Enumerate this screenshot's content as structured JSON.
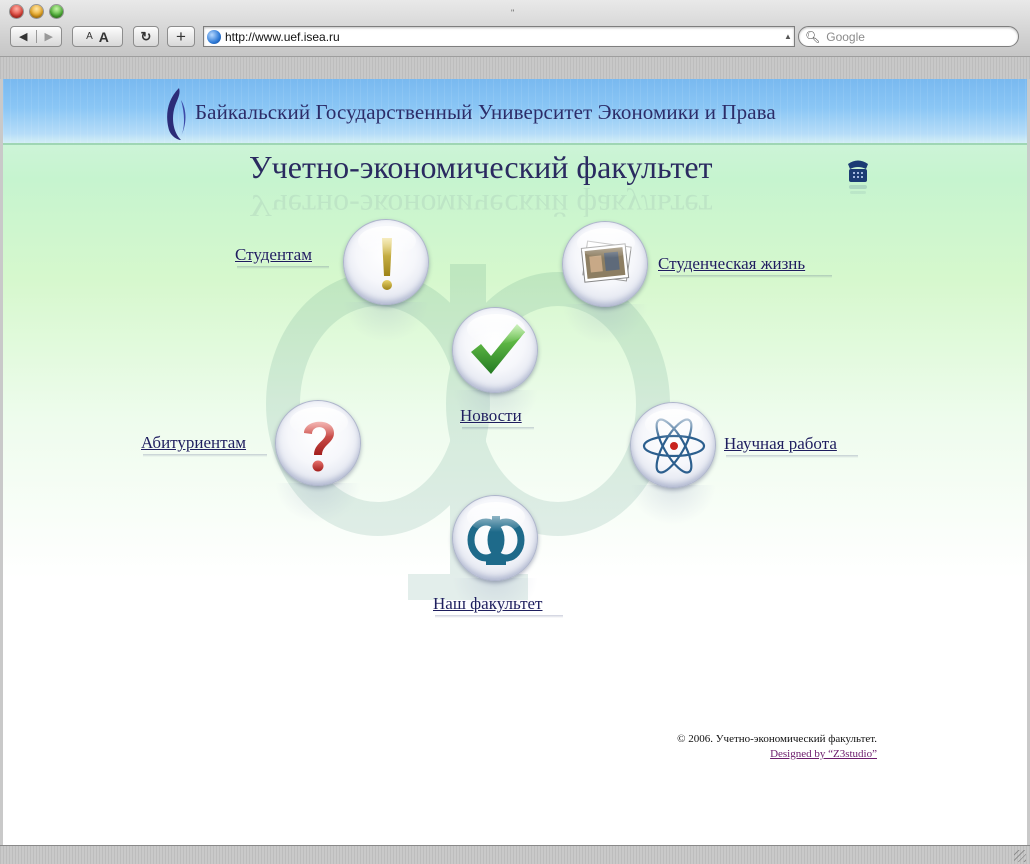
{
  "browser": {
    "url": "http://www.uef.isea.ru",
    "search_placeholder": "Google",
    "text_small_label": "A",
    "text_large_label": "A",
    "reload_label": "C",
    "add_label": "+"
  },
  "header": {
    "university": "Байкальский Государственный Университет Экономики и Права",
    "faculty": "Учетно-экономический  факультет"
  },
  "nav": {
    "students": "Студентам",
    "student_life": "Студенческая жизнь",
    "news": "Новости",
    "applicants": "Абитуриентам",
    "science": "Научная работа",
    "our_faculty": "Наш факультет"
  },
  "footer": {
    "copyright": "© 2006. Учетно-экономический факультет.",
    "designed_by": "Designed by “Z3studio”"
  },
  "icons": {
    "students": "exclamation-icon",
    "student_life": "photos-icon",
    "news": "checkmark-icon",
    "applicants": "question-mark-icon",
    "science": "atom-icon",
    "our_faculty": "faculty-logo-icon",
    "phone": "phone-icon"
  },
  "colors": {
    "link": "#1e1e5e",
    "title": "#2a2a60",
    "header_blue": "#8ac6f5",
    "page_green": "#c6f4cf",
    "visited_link": "#6b1a6b"
  }
}
